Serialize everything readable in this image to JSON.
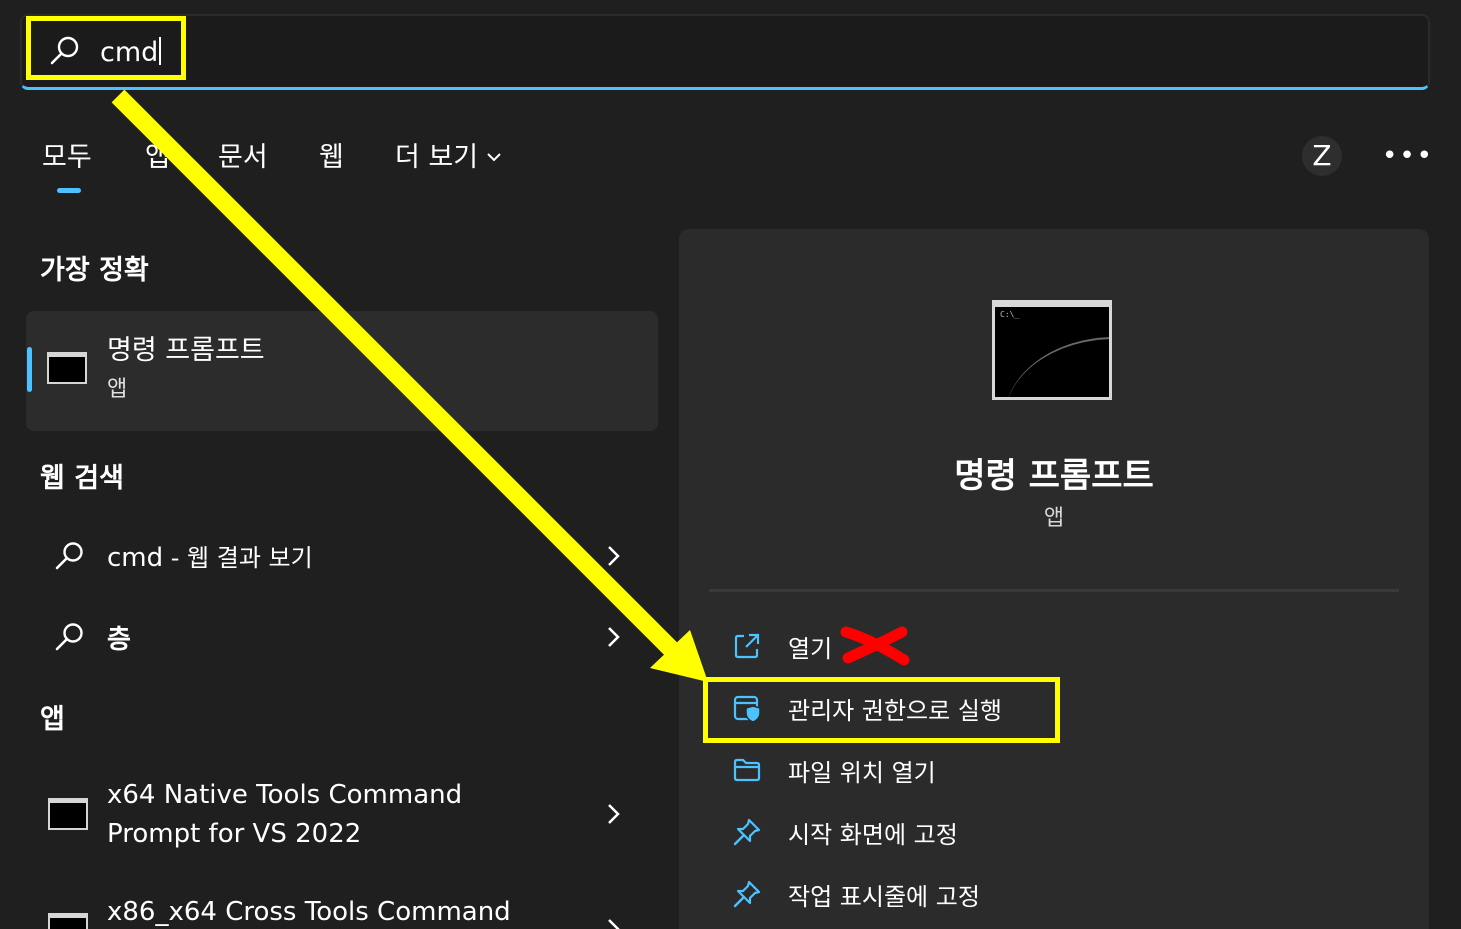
{
  "search": {
    "query": "cmd"
  },
  "tabs": [
    {
      "label": "모두",
      "active": true
    },
    {
      "label": "앱"
    },
    {
      "label": "문서"
    },
    {
      "label": "웹"
    },
    {
      "label": "더 보기"
    }
  ],
  "account": {
    "initial": "Z"
  },
  "more_label": "•••",
  "best_match": {
    "heading": "가장 정확",
    "title": "명령 프롬프트",
    "subtitle": "앱",
    "icon": "command-prompt-icon"
  },
  "web_search": {
    "heading": "웹 검색",
    "items": [
      {
        "query": "cmd",
        "suffix": " - 웹 결과 보기"
      },
      {
        "query": "층",
        "suffix": ""
      }
    ]
  },
  "apps": {
    "heading": "앱",
    "items": [
      {
        "line1": "x64 Native Tools Command",
        "line2": "Prompt for VS 2022"
      },
      {
        "line1": "x86_x64 Cross Tools Command",
        "line2": ""
      }
    ]
  },
  "detail": {
    "title": "명령 프롬프트",
    "subtitle": "앱",
    "prompt_text": "C:\\_",
    "actions": [
      {
        "label": "열기",
        "icon": "open-external-icon"
      },
      {
        "label": "관리자 권한으로 실행",
        "icon": "admin-shield-icon"
      },
      {
        "label": "파일 위치 열기",
        "icon": "folder-icon"
      },
      {
        "label": "시작 화면에 고정",
        "icon": "pin-icon"
      },
      {
        "label": "작업 표시줄에 고정",
        "icon": "pin-icon"
      }
    ]
  },
  "colors": {
    "accent": "#4cc2ff",
    "highlight": "#ffff00",
    "cross": "#ff0000",
    "background": "#1f1f1f",
    "pane": "#2b2b2b"
  }
}
